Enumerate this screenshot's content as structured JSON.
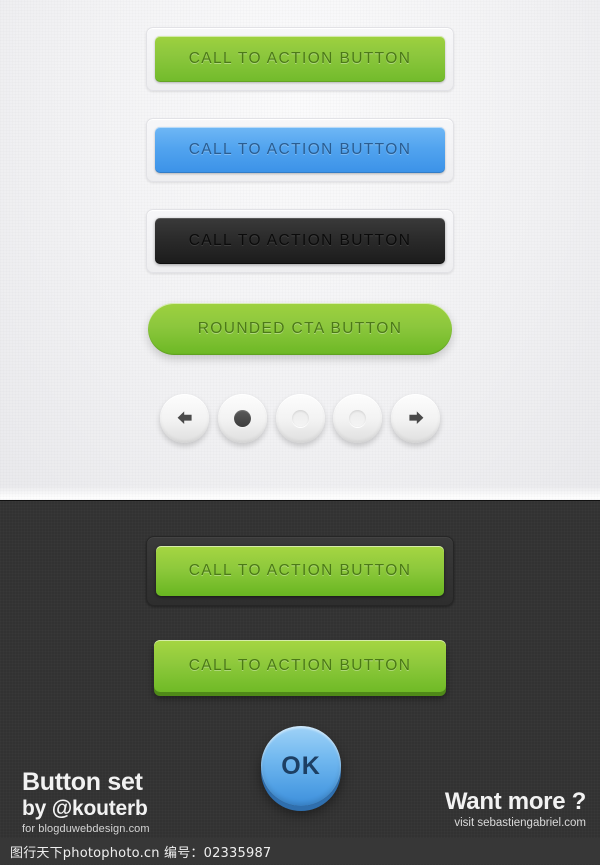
{
  "light_section": {
    "buttons": [
      {
        "label": "CALL TO ACTION BUTTON",
        "style": "green",
        "name": "cta-button-green"
      },
      {
        "label": "CALL TO ACTION BUTTON",
        "style": "blue",
        "name": "cta-button-blue"
      },
      {
        "label": "CALL TO ACTION BUTTON",
        "style": "dark",
        "name": "cta-button-dark"
      }
    ],
    "pill_button": {
      "label": "ROUNDED CTA BUTTON"
    },
    "circle_nav": [
      {
        "icon": "arrow-left-icon",
        "state": "arrow"
      },
      {
        "icon": "dot-filled-icon",
        "state": "active"
      },
      {
        "icon": "dot-empty-icon",
        "state": "idle"
      },
      {
        "icon": "dot-empty-icon",
        "state": "idle"
      },
      {
        "icon": "arrow-right-icon",
        "state": "arrow"
      }
    ]
  },
  "dark_section": {
    "buttons": [
      {
        "label": "CALL TO ACTION BUTTON",
        "style": "framed-green"
      },
      {
        "label": "CALL TO ACTION BUTTON",
        "style": "3d-green"
      }
    ],
    "ok_button": {
      "label": "OK"
    },
    "footer_left": {
      "line1": "Button set",
      "line2": "by @kouterb",
      "line3": "for blogduwebdesign.com"
    },
    "footer_right": {
      "line1": "Want more ?",
      "line2": "visit sebastiengabriel.com"
    }
  },
  "watermark": {
    "text": "图行天下photophoto.cn  编号：02335987"
  },
  "colors": {
    "green_light": "#9ed13f",
    "green_dark": "#72bb2b",
    "green_3d_edge": "#4f8a18",
    "green_text": "#4c7a18",
    "blue_light": "#6fb7f5",
    "blue_dark": "#3b92e8",
    "blue_text": "#2a5d91",
    "ok_blue_light": "#9fd2f7",
    "ok_blue_dark": "#3e8fdb",
    "ok_blue_edge": "#2f6fae",
    "dark_btn_top": "#3a3a3a",
    "dark_btn_bottom": "#1b1b1b",
    "panel_dark_bg": "#323232",
    "panel_light_bg": "#f1f1f3",
    "watermark_bg": "#373737"
  }
}
